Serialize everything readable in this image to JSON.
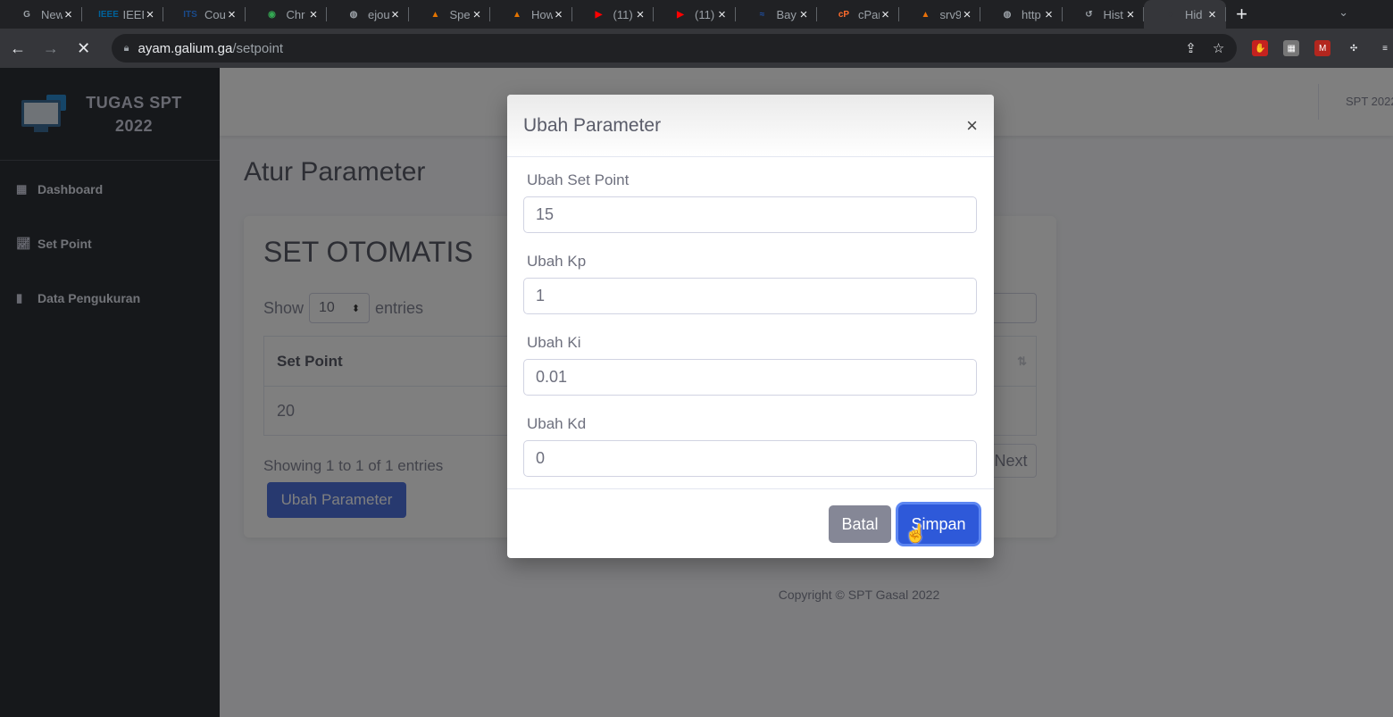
{
  "browser": {
    "tabs": [
      {
        "title": "New",
        "fav_color": "#9aa0a6",
        "fav_text": "G",
        "icon": "chrome-icon"
      },
      {
        "title": "IEEE",
        "fav_color": "#00629b",
        "fav_text": "IEEE",
        "icon": "ieee-icon"
      },
      {
        "title": "Cou",
        "fav_color": "#1a4b8c",
        "fav_text": "ITS",
        "icon": "its-icon"
      },
      {
        "title": "Chr",
        "fav_color": "#34a853",
        "fav_text": "◉",
        "icon": "maps-pin-icon"
      },
      {
        "title": "ejou",
        "fav_color": "#9aa0a6",
        "fav_text": "◍",
        "icon": "globe-icon"
      },
      {
        "title": "Spe",
        "fav_color": "#e37400",
        "fav_text": "▲",
        "icon": "matlab-icon"
      },
      {
        "title": "How",
        "fav_color": "#e37400",
        "fav_text": "▲",
        "icon": "matlab-icon"
      },
      {
        "title": "(11)",
        "fav_color": "#ff0000",
        "fav_text": "▶",
        "icon": "youtube-icon"
      },
      {
        "title": "(11)",
        "fav_color": "#ff0000",
        "fav_text": "▶",
        "icon": "youtube-icon"
      },
      {
        "title": "Bay",
        "fav_color": "#1e4fa3",
        "fav_text": "≈",
        "icon": "bay-icon"
      },
      {
        "title": "cPar",
        "fav_color": "#ff6c2c",
        "fav_text": "cP",
        "icon": "cpanel-icon"
      },
      {
        "title": "srv9",
        "fav_color": "#e8710a",
        "fav_text": "▲",
        "icon": "server-icon"
      },
      {
        "title": "http",
        "fav_color": "#9aa0a6",
        "fav_text": "◍",
        "icon": "globe-icon"
      },
      {
        "title": "Hist",
        "fav_color": "#9aa0a6",
        "fav_text": "↺",
        "icon": "history-icon"
      },
      {
        "title": "Hid",
        "fav_color": "#35363a",
        "fav_text": "◌",
        "icon": "loading-icon"
      }
    ],
    "active_tab_index": 14,
    "url_host": "ayam.galium.ga",
    "url_path": "/setpoint"
  },
  "sidebar": {
    "brand": "TUGAS SPT 2022",
    "items": [
      {
        "label": "Dashboard",
        "icon": "table-icon"
      },
      {
        "label": "Set Point",
        "icon": "chart-line-icon"
      },
      {
        "label": "Data Pengukuran",
        "icon": "file-icon"
      }
    ]
  },
  "topbar": {
    "user": "SPT 2022"
  },
  "main": {
    "page_title": "Atur Parameter",
    "card_title": "SET OTOMATIS",
    "show_label": "Show",
    "entries_label": "entries",
    "page_size": "10",
    "table_header": "Set Point",
    "table_rows": [
      "20"
    ],
    "info": "Showing 1 to 1 of 1 entries",
    "next_label": "Next",
    "ubah_button": "Ubah Parameter"
  },
  "footer": "Copyright © SPT Gasal 2022",
  "modal": {
    "title": "Ubah Parameter",
    "close": "×",
    "fields": [
      {
        "label": "Ubah Set Point",
        "value": "15"
      },
      {
        "label": "Ubah Kp",
        "value": "1"
      },
      {
        "label": "Ubah Ki",
        "value": "0.01"
      },
      {
        "label": "Ubah Kd",
        "value": "0"
      }
    ],
    "cancel": "Batal",
    "save": "Simpan"
  }
}
